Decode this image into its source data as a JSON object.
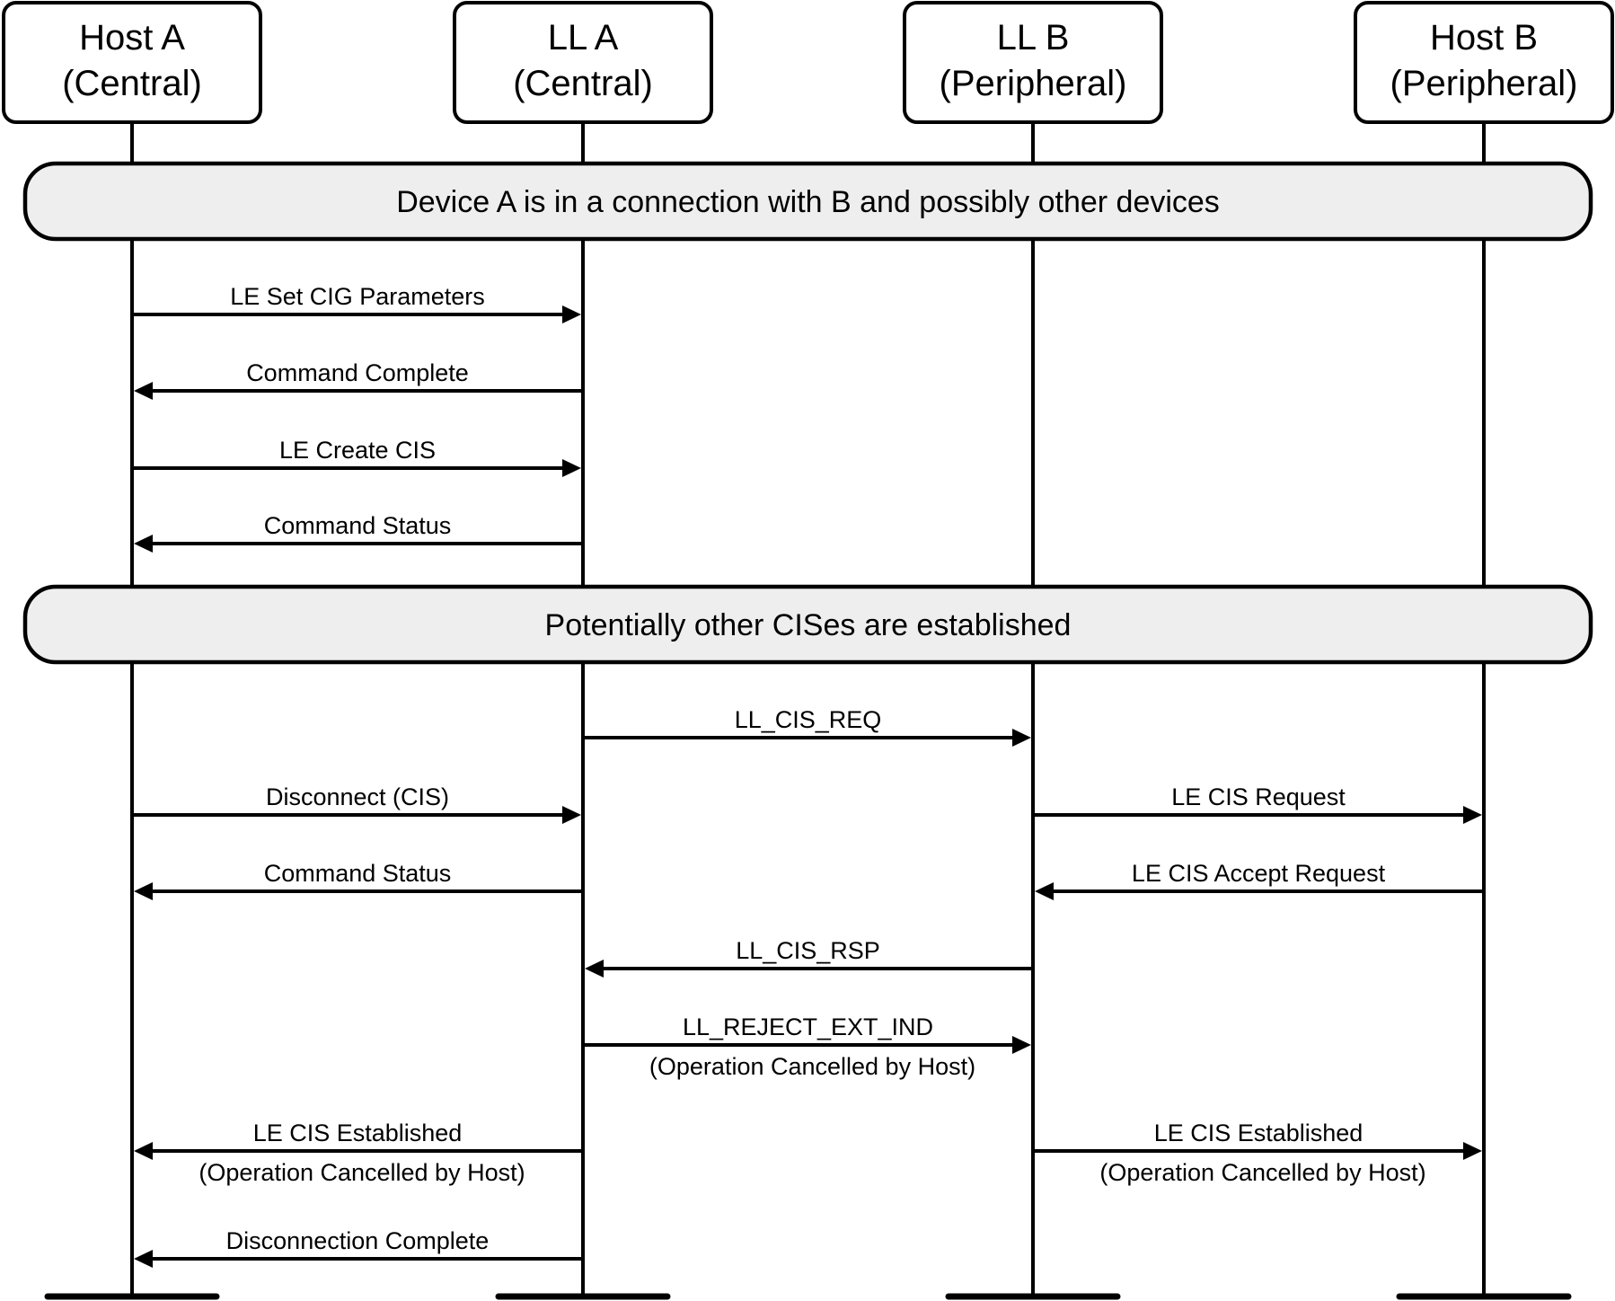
{
  "diagram": {
    "type": "sequence",
    "participants": [
      {
        "id": "hostA",
        "line1": "Host A",
        "line2": "(Central)"
      },
      {
        "id": "llA",
        "line1": "LL A",
        "line2": "(Central)"
      },
      {
        "id": "llB",
        "line1": "LL B",
        "line2": "(Peripheral)"
      },
      {
        "id": "hostB",
        "line1": "Host B",
        "line2": "(Peripheral)"
      }
    ],
    "steps": [
      {
        "kind": "band",
        "text": "Device A is in a connection with B and possibly other devices"
      },
      {
        "kind": "message",
        "from": "hostA",
        "to": "llA",
        "label": "LE Set CIG Parameters",
        "sublabel": ""
      },
      {
        "kind": "message",
        "from": "llA",
        "to": "hostA",
        "label": "Command Complete",
        "sublabel": ""
      },
      {
        "kind": "message",
        "from": "hostA",
        "to": "llA",
        "label": "LE Create CIS",
        "sublabel": ""
      },
      {
        "kind": "message",
        "from": "llA",
        "to": "hostA",
        "label": "Command Status",
        "sublabel": ""
      },
      {
        "kind": "band",
        "text": "Potentially other CISes are established"
      },
      {
        "kind": "message",
        "from": "llA",
        "to": "llB",
        "label": "LL_CIS_REQ",
        "sublabel": ""
      },
      {
        "kind": "message",
        "from": "hostA",
        "to": "llA",
        "label": "Disconnect (CIS)",
        "sublabel": ""
      },
      {
        "kind": "message",
        "from": "llB",
        "to": "hostB",
        "label": "LE CIS Request",
        "sublabel": ""
      },
      {
        "kind": "message",
        "from": "llA",
        "to": "hostA",
        "label": "Command Status",
        "sublabel": ""
      },
      {
        "kind": "message",
        "from": "hostB",
        "to": "llB",
        "label": "LE CIS Accept Request",
        "sublabel": ""
      },
      {
        "kind": "message",
        "from": "llB",
        "to": "llA",
        "label": "LL_CIS_RSP",
        "sublabel": ""
      },
      {
        "kind": "message",
        "from": "llA",
        "to": "llB",
        "label": "LL_REJECT_EXT_IND",
        "sublabel": "(Operation Cancelled by Host)"
      },
      {
        "kind": "message",
        "from": "llA",
        "to": "hostA",
        "label": "LE CIS Established",
        "sublabel": "(Operation Cancelled by Host)"
      },
      {
        "kind": "message",
        "from": "llB",
        "to": "hostB",
        "label": "LE CIS Established",
        "sublabel": "(Operation Cancelled by Host)"
      },
      {
        "kind": "message",
        "from": "llA",
        "to": "hostA",
        "label": "Disconnection Complete",
        "sublabel": ""
      }
    ]
  },
  "colors": {
    "band_fill": "#eeeeee",
    "stroke": "#000000",
    "background": "#ffffff"
  }
}
